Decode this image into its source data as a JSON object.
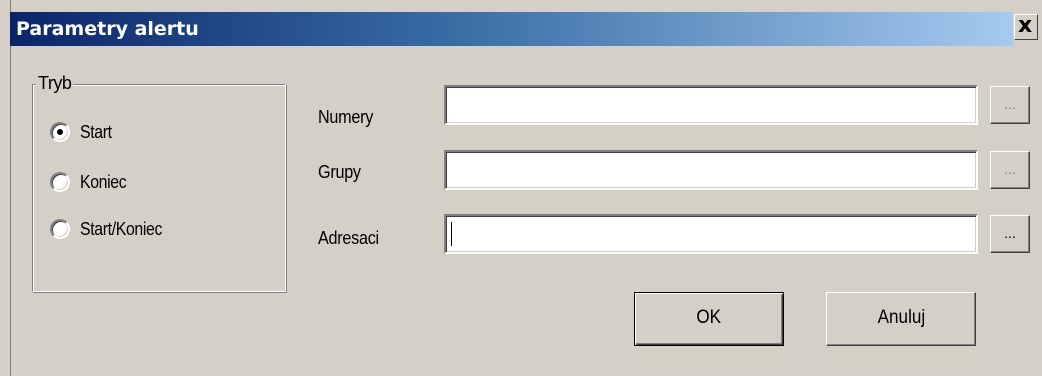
{
  "window": {
    "title": "Parametry alertu",
    "close_glyph": "x"
  },
  "mode_group": {
    "label": "Tryb",
    "options": [
      {
        "label": "Start",
        "selected": true
      },
      {
        "label": "Koniec",
        "selected": false
      },
      {
        "label": "Start/Koniec",
        "selected": false
      }
    ]
  },
  "fields": [
    {
      "label": "Numery",
      "value": "",
      "browse_label": "...",
      "browse_enabled": false
    },
    {
      "label": "Grupy",
      "value": "",
      "browse_label": "...",
      "browse_enabled": false
    },
    {
      "label": "Adresaci",
      "value": "",
      "browse_label": "...",
      "browse_enabled": true,
      "focused": true
    }
  ],
  "buttons": {
    "ok_label": "OK",
    "cancel_label": "Anuluj"
  },
  "colors": {
    "dialog_face": "#d4d0c8",
    "title_start": "#0a246a",
    "title_end": "#a6caf0",
    "title_text": "#ffffff"
  }
}
